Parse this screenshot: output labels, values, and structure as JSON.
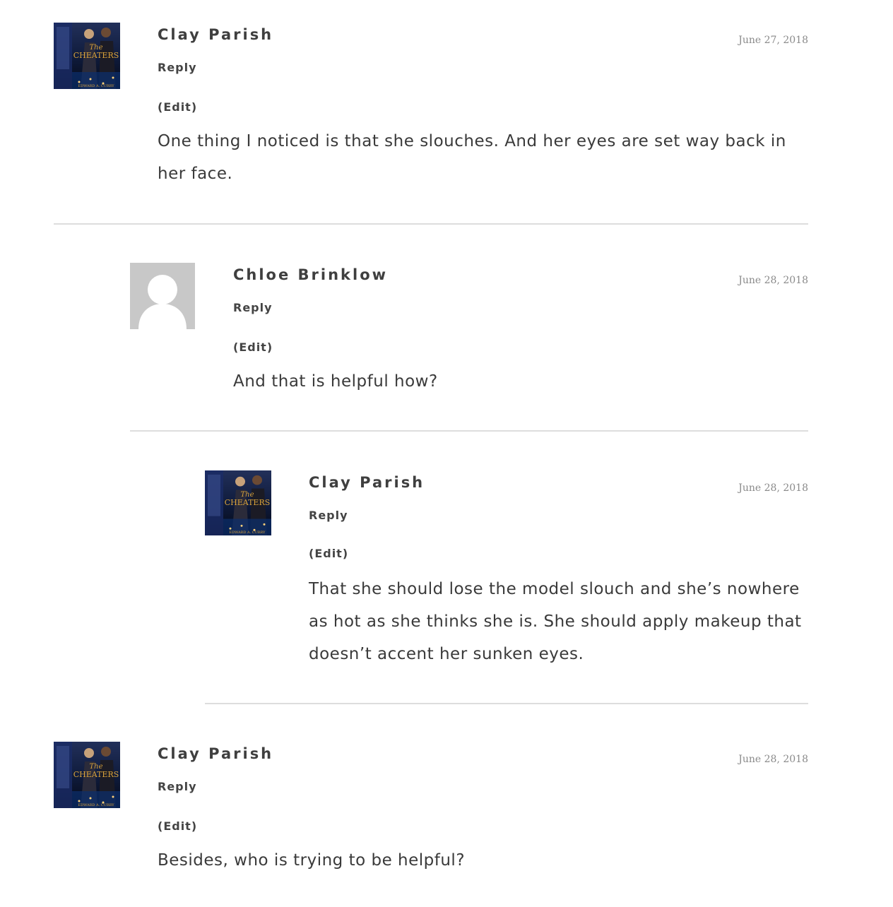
{
  "comments": [
    {
      "author": "Clay Parish",
      "date": "June 27, 2018",
      "reply": "Reply",
      "edit": "(Edit)",
      "text": "One thing I noticed is that she slouches. And her eyes are set way back in her face.",
      "avatar": "book-cover"
    },
    {
      "author": "Chloe Brinklow",
      "date": "June 28, 2018",
      "reply": "Reply",
      "edit": "(Edit)",
      "text": "And that is helpful how?",
      "avatar": "default-person"
    },
    {
      "author": "Clay Parish",
      "date": "June 28, 2018",
      "reply": "Reply",
      "edit": "(Edit)",
      "text": "That she should lose the model slouch and she’s nowhere as hot as she thinks she is. She should apply makeup that doesn’t accent her sunken eyes.",
      "avatar": "book-cover"
    },
    {
      "author": "Clay Parish",
      "date": "June 28, 2018",
      "reply": "Reply",
      "edit": "(Edit)",
      "text": "Besides, who is trying to be helpful?",
      "avatar": "book-cover"
    }
  ],
  "book_cover": {
    "title_script": "The",
    "title": "CHEATERS",
    "author_line": "EDWARD A. CURRY"
  },
  "colors": {
    "text": "#3c3c3c",
    "date": "#8a8a8a",
    "divider": "#dddddd",
    "cover_dark": "#0e1a3a",
    "cover_gold": "#d9a23a"
  }
}
